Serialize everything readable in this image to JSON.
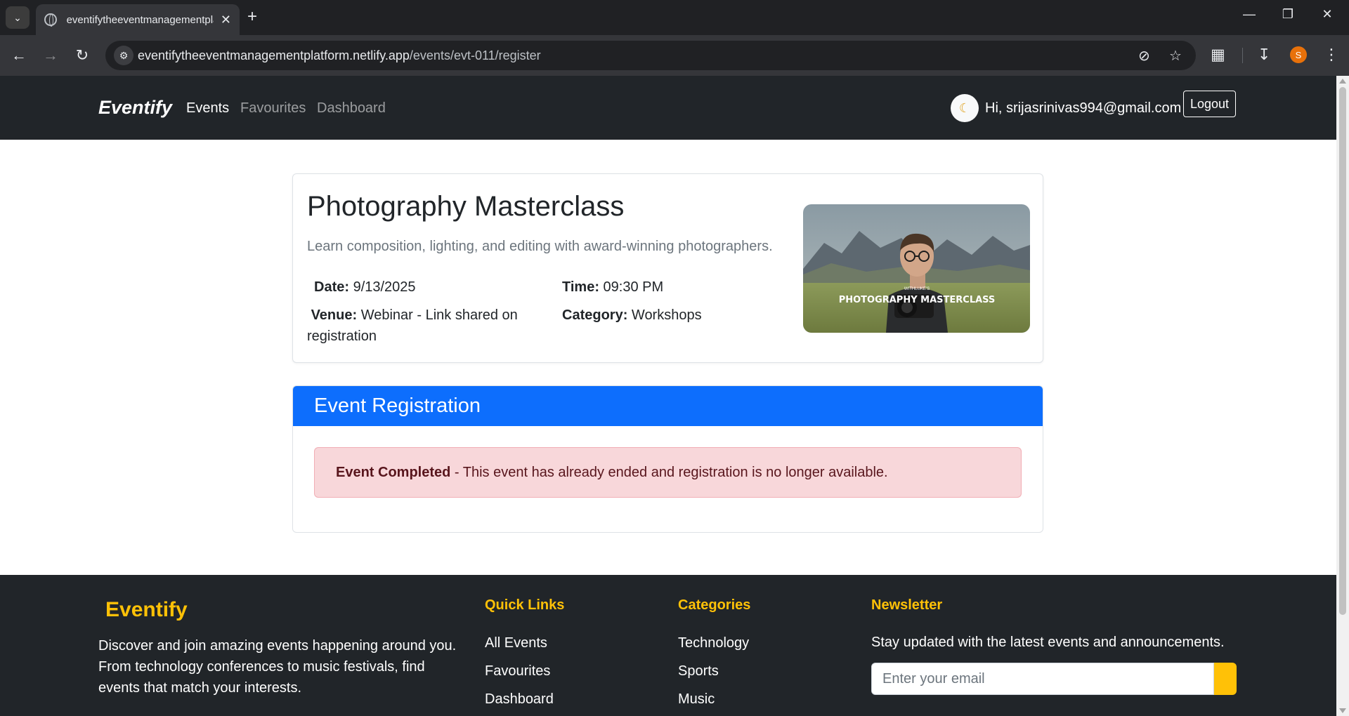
{
  "browser": {
    "tab_title": "eventifytheeventmanagementplatform",
    "url_host": "eventifytheeventmanagementplatform.netlify.app",
    "url_path": "/events/evt-011/register",
    "profile_initial": "S",
    "icons": [
      "tab-list-icon",
      "globe-icon",
      "close-icon",
      "new-tab-icon",
      "minimize-icon",
      "restore-icon",
      "window-close-icon",
      "back-icon",
      "forward-icon",
      "reload-icon",
      "site-info-icon",
      "eye-off-icon",
      "star-icon",
      "extensions-icon",
      "download-icon",
      "kebab-menu-icon"
    ]
  },
  "navbar": {
    "brand": "Eventify",
    "links": [
      "Events",
      "Favourites",
      "Dashboard"
    ],
    "active": "Events",
    "greeting": "Hi, srijasrinivas994@gmail.com",
    "logout_label": "Logout",
    "theme_icon": "moon-icon"
  },
  "event": {
    "title": "Photography Masterclass",
    "description": "Learn composition, lighting, and editing with award-winning photographers.",
    "date_label": "Date:",
    "date": "9/13/2025",
    "time_label": "Time:",
    "time": "09:30 PM",
    "venue_label": "Venue:",
    "venue_line1": "Webinar - Link shared on",
    "venue_line2": "registration",
    "category_label": "Category:",
    "category": "Workshops",
    "image_caption_small": "WITHLUKE'S",
    "image_caption": "PHOTOGRAPHY MASTERCLASS"
  },
  "registration": {
    "title": "Event Registration",
    "alert_strong": "Event Completed",
    "alert_text": " - This event has already ended and registration is no longer available.",
    "alert_color": "#f8d7da",
    "header_color": "#0d6efd"
  },
  "footer": {
    "brand": "Eventify",
    "about_line1": "Discover and join amazing events happening around you.",
    "about_line2": "From technology conferences to music festivals, find",
    "about_line3": "events that match your interests.",
    "quick_links_title": "Quick Links",
    "quick_links": [
      "All Events",
      "Favourites",
      "Dashboard"
    ],
    "categories_title": "Categories",
    "categories": [
      "Technology",
      "Sports",
      "Music"
    ],
    "newsletter_title": "Newsletter",
    "newsletter_text": "Stay updated with the latest events and announcements.",
    "email_placeholder": "Enter your email",
    "accent_color": "#ffc107"
  }
}
